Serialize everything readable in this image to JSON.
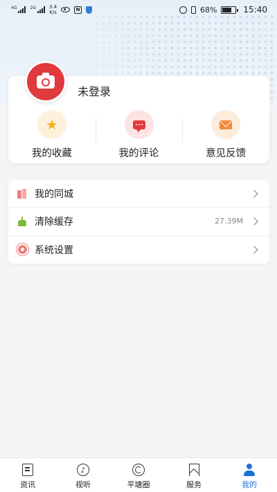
{
  "status_bar": {
    "sim1_tag": "4G",
    "sim2_tag": "2G",
    "speed_value": "3.4",
    "speed_unit": "K/s",
    "nfc_label": "N",
    "battery_percent": "68%",
    "battery_level": 0.68,
    "time": "15:40"
  },
  "profile": {
    "login_text": "未登录",
    "quick_actions": [
      {
        "label": "我的收藏",
        "icon": "star-icon",
        "bg": "#fdf1dc"
      },
      {
        "label": "我的评论",
        "icon": "comment-icon",
        "bg": "#fde3e3"
      },
      {
        "label": "意见反馈",
        "icon": "envelope-icon",
        "bg": "#fdebdc"
      }
    ]
  },
  "menu": [
    {
      "label": "我的同城",
      "value": "",
      "icon": "building-icon"
    },
    {
      "label": "清除缓存",
      "value": "27.39M",
      "icon": "broom-icon"
    },
    {
      "label": "系统设置",
      "value": "",
      "icon": "gear-icon"
    }
  ],
  "bottom_nav": [
    {
      "label": "资讯",
      "icon": "news-icon"
    },
    {
      "label": "视听",
      "icon": "music-icon"
    },
    {
      "label": "平塘圈",
      "icon": "circle-icon"
    },
    {
      "label": "服务",
      "icon": "bookmark-icon"
    },
    {
      "label": "我的",
      "icon": "person-icon",
      "active": true
    }
  ],
  "colors": {
    "accent": "#1d6fd8",
    "avatar_red": "#e0393e"
  }
}
